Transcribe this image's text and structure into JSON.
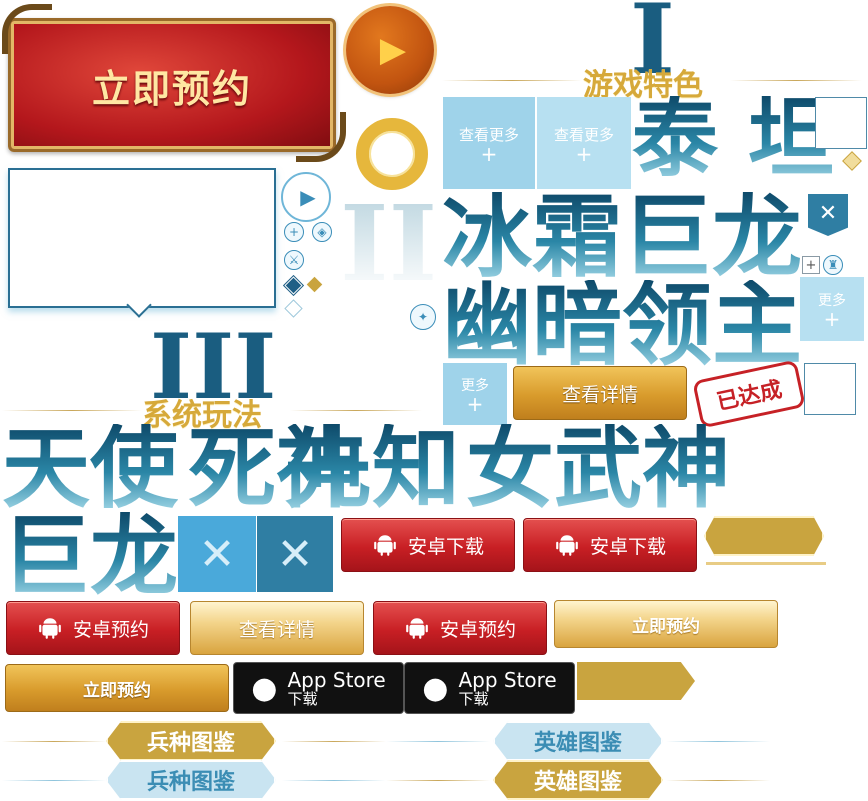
{
  "reserve_banner": {
    "label": "立即预约",
    "colors": {
      "frame": "#9a6a2a",
      "fill": "#b4171c"
    }
  },
  "sections": {
    "features_title": "游戏特色",
    "systems_title": "系统玩法"
  },
  "roman_numerals": {
    "one": "I",
    "two": "II",
    "three": "III"
  },
  "big_words": {
    "titan": "泰 坦",
    "frost_dragon": "冰霜巨龙",
    "dark_lord": "幽暗领主",
    "angel": "天使",
    "death": "死神",
    "prophet": "先知",
    "valkyrie": "女武神",
    "giant_dragon": "巨龙"
  },
  "tiles": {
    "view_more_1": {
      "label": "查看更多",
      "plus": "+"
    },
    "view_more_2": {
      "label": "查看更多",
      "plus": "+"
    },
    "more_right": {
      "label": "更多",
      "plus": "+"
    },
    "more_left": {
      "label": "更多",
      "plus": "+"
    }
  },
  "buttons": {
    "view_details_top": "查看详情",
    "achieved_stamp": "已达成",
    "android_download_1": "安卓下载",
    "android_download_2": "安卓下载",
    "android_reserve_1": "安卓预约",
    "view_details": "查看详情",
    "android_reserve_2": "安卓预约",
    "reserve_now_1": "立即预约",
    "reserve_now_2": "立即预约",
    "appstore_1": {
      "title": "App Store",
      "sub": "下载"
    },
    "appstore_2": {
      "title": "App Store",
      "sub": "下载"
    }
  },
  "tabs": {
    "unit_atlas_gold": "兵种图鉴",
    "hero_atlas_blue": "英雄图鉴",
    "unit_atlas_blue": "兵种图鉴",
    "hero_atlas_gold": "英雄图鉴"
  },
  "glyphs": {
    "close": "✕",
    "play": "▶",
    "plus": "+"
  },
  "colors": {
    "gold": "#c9a43f",
    "blue": "#2f7ea3",
    "red": "#c81f24",
    "tile": "#9fd3ea"
  }
}
